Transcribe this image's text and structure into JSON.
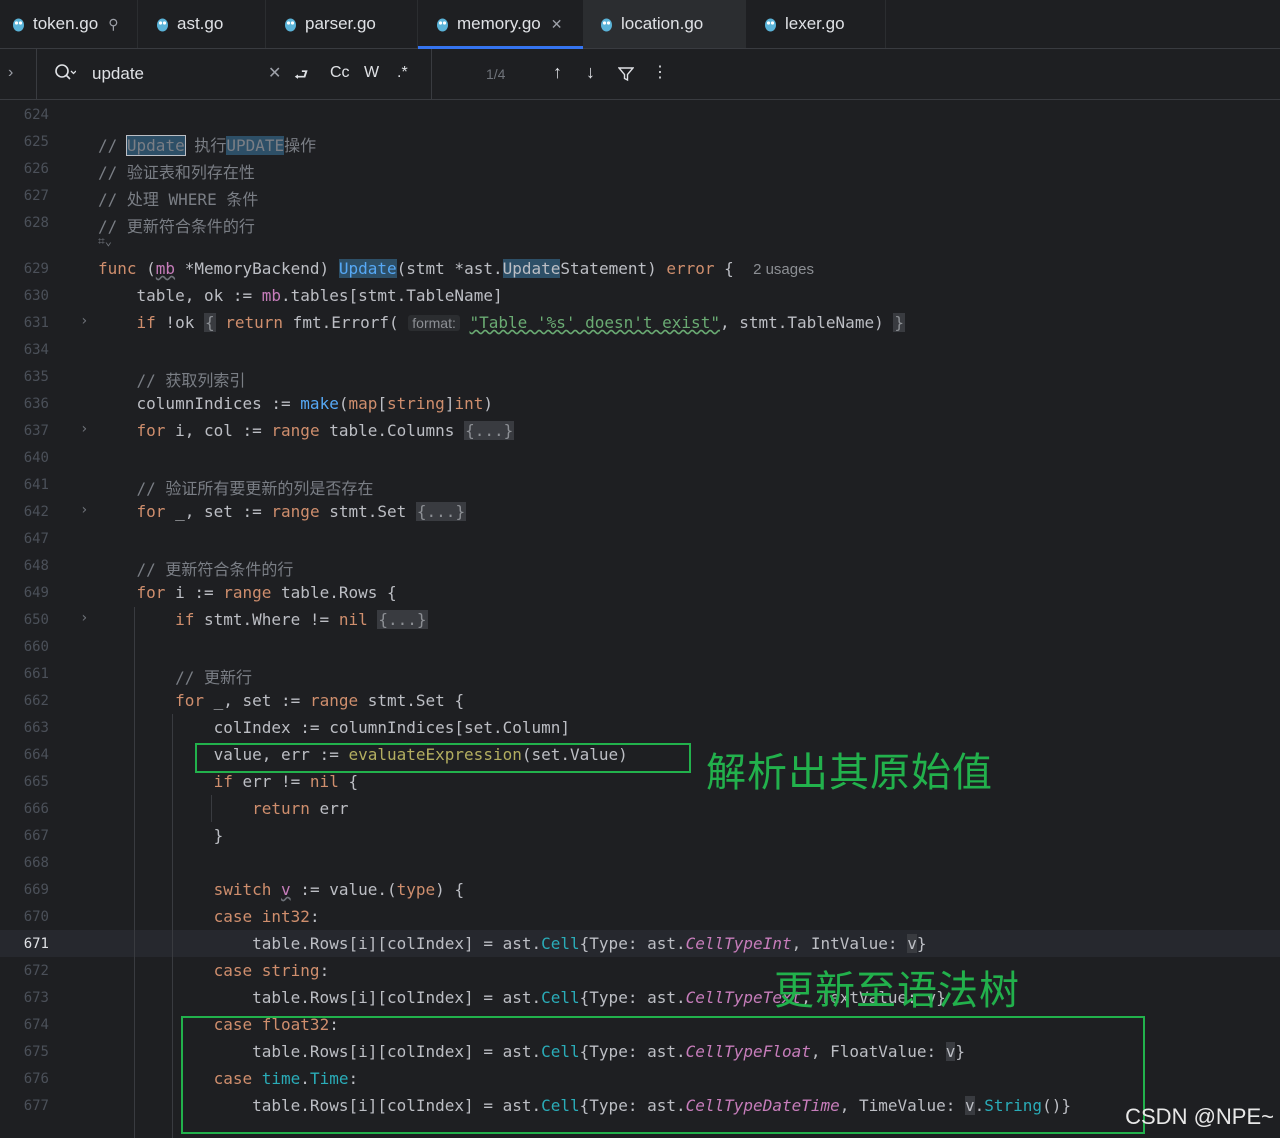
{
  "tabs": [
    {
      "label": "token.go",
      "pinned": true
    },
    {
      "label": "ast.go"
    },
    {
      "label": "parser.go"
    },
    {
      "label": "memory.go",
      "active": true
    },
    {
      "label": "location.go"
    },
    {
      "label": "lexer.go"
    }
  ],
  "find": {
    "query": "update",
    "opt_cc": "Cc",
    "opt_w": "W",
    "opt_regex": ".*",
    "match_count": "1/4"
  },
  "lines": {
    "l624": "624",
    "l625": "625",
    "l626": "626",
    "l627": "627",
    "l628": "628",
    "l629": "629",
    "l630": "630",
    "l631": "631",
    "l634": "634",
    "l635": "635",
    "l636": "636",
    "l637": "637",
    "l640": "640",
    "l641": "641",
    "l642": "642",
    "l647": "647",
    "l648": "648",
    "l649": "649",
    "l650": "650",
    "l660": "660",
    "l661": "661",
    "l662": "662",
    "l663": "663",
    "l664": "664",
    "l665": "665",
    "l666": "666",
    "l667": "667",
    "l668": "668",
    "l669": "669",
    "l670": "670",
    "l671": "671",
    "l672": "672",
    "l673": "673",
    "l674": "674",
    "l675": "675",
    "l676": "676",
    "l677": "677"
  },
  "comments": {
    "c625_a": "// ",
    "c625_word": "Update",
    "c625_b": " 执行",
    "c625_word2": "UPDATE",
    "c625_c": "操作",
    "c626": "// 验证表和列存在性",
    "c627": "// 处理 WHERE 条件",
    "c628": "// 更新符合条件的行",
    "c635": "// 获取列索引",
    "c641": "// 验证所有要更新的列是否存在",
    "c648": "// 更新符合条件的行",
    "c661": "// 更新行"
  },
  "usages": "2 usages",
  "hint_format": "format:",
  "fold_text": "{...}",
  "annotations": {
    "parse_value": "解析出其原始值",
    "update_tree": "更新至语法树"
  },
  "watermark": "CSDN @NPE~",
  "accent": "#3574f0",
  "annotation_color": "#22b14c"
}
